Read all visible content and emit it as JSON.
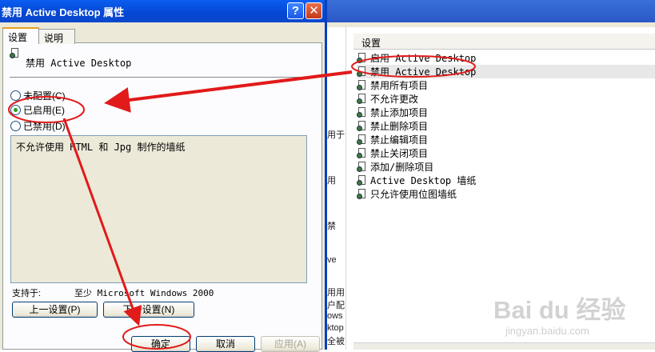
{
  "dialog": {
    "title": "禁用 Active Desktop 属性",
    "help_button": "?",
    "close_button": "✕",
    "tabs": [
      {
        "label": "设置"
      },
      {
        "label": "说明"
      }
    ],
    "policy_name": "禁用 Active Desktop",
    "options": [
      {
        "label": "未配置(C)",
        "checked": false
      },
      {
        "label": "已启用(E)",
        "checked": true
      },
      {
        "label": "已禁用(D)",
        "checked": false
      }
    ],
    "comment": "不允许使用 HTML 和 Jpg 制作的墙纸",
    "supported_label": "支持于:",
    "supported_value": "至少 Microsoft Windows 2000",
    "prev_button": "上一设置(P)",
    "next_button": "下一设置(N)",
    "ok_button": "确定",
    "cancel_button": "取消",
    "apply_button": "应用(A)"
  },
  "background_window": {
    "left_strip_fragments": [
      "用于",
      "用",
      "禁",
      "ve",
      "用用",
      "户配",
      "ows",
      "ktop",
      "全被"
    ],
    "list_header": "设置",
    "list_items": [
      {
        "label": "启用 Active Desktop",
        "selected": false
      },
      {
        "label": "禁用 Active Desktop",
        "selected": true
      },
      {
        "label": "禁用所有项目",
        "selected": false
      },
      {
        "label": "不允许更改",
        "selected": false
      },
      {
        "label": "禁止添加项目",
        "selected": false
      },
      {
        "label": "禁止删除项目",
        "selected": false
      },
      {
        "label": "禁止编辑项目",
        "selected": false
      },
      {
        "label": "禁止关闭项目",
        "selected": false
      },
      {
        "label": "添加/删除项目",
        "selected": false
      },
      {
        "label": "Active Desktop 墙纸",
        "selected": false
      },
      {
        "label": "只允许使用位图墙纸",
        "selected": false
      }
    ]
  },
  "watermark": {
    "logo": "Bai du 经验",
    "url": "jingyan.baidu.com"
  },
  "colors": {
    "annotation_red": "#e11a1a",
    "title_blue": "#0a50e0"
  }
}
